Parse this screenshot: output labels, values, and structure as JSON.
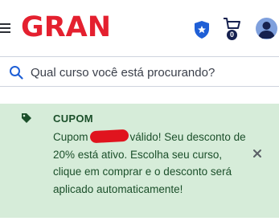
{
  "header": {
    "logo_text": "GRAN",
    "icons": {
      "menu": "hamburger-menu-icon",
      "badge": "shield-star-icon",
      "cart": "shopping-cart-icon",
      "profile": "user-avatar-icon"
    },
    "cart_count": "0",
    "colors": {
      "brand_navy": "#16214f",
      "brand_red": "#e4202f",
      "badge_blue": "#1f5fd6"
    }
  },
  "search": {
    "placeholder": "Qual curso você está procurando?",
    "value": ""
  },
  "coupon_banner": {
    "title": "CUPOM",
    "message_prefix": "Cupom",
    "message_rest": "válido! Seu desconto de 20% está ativo. Escolha seu curso, clique em comprar e o desconto será aplicado automaticamente!",
    "colors": {
      "background": "#d6ecd9",
      "text": "#1b4f2a"
    }
  }
}
